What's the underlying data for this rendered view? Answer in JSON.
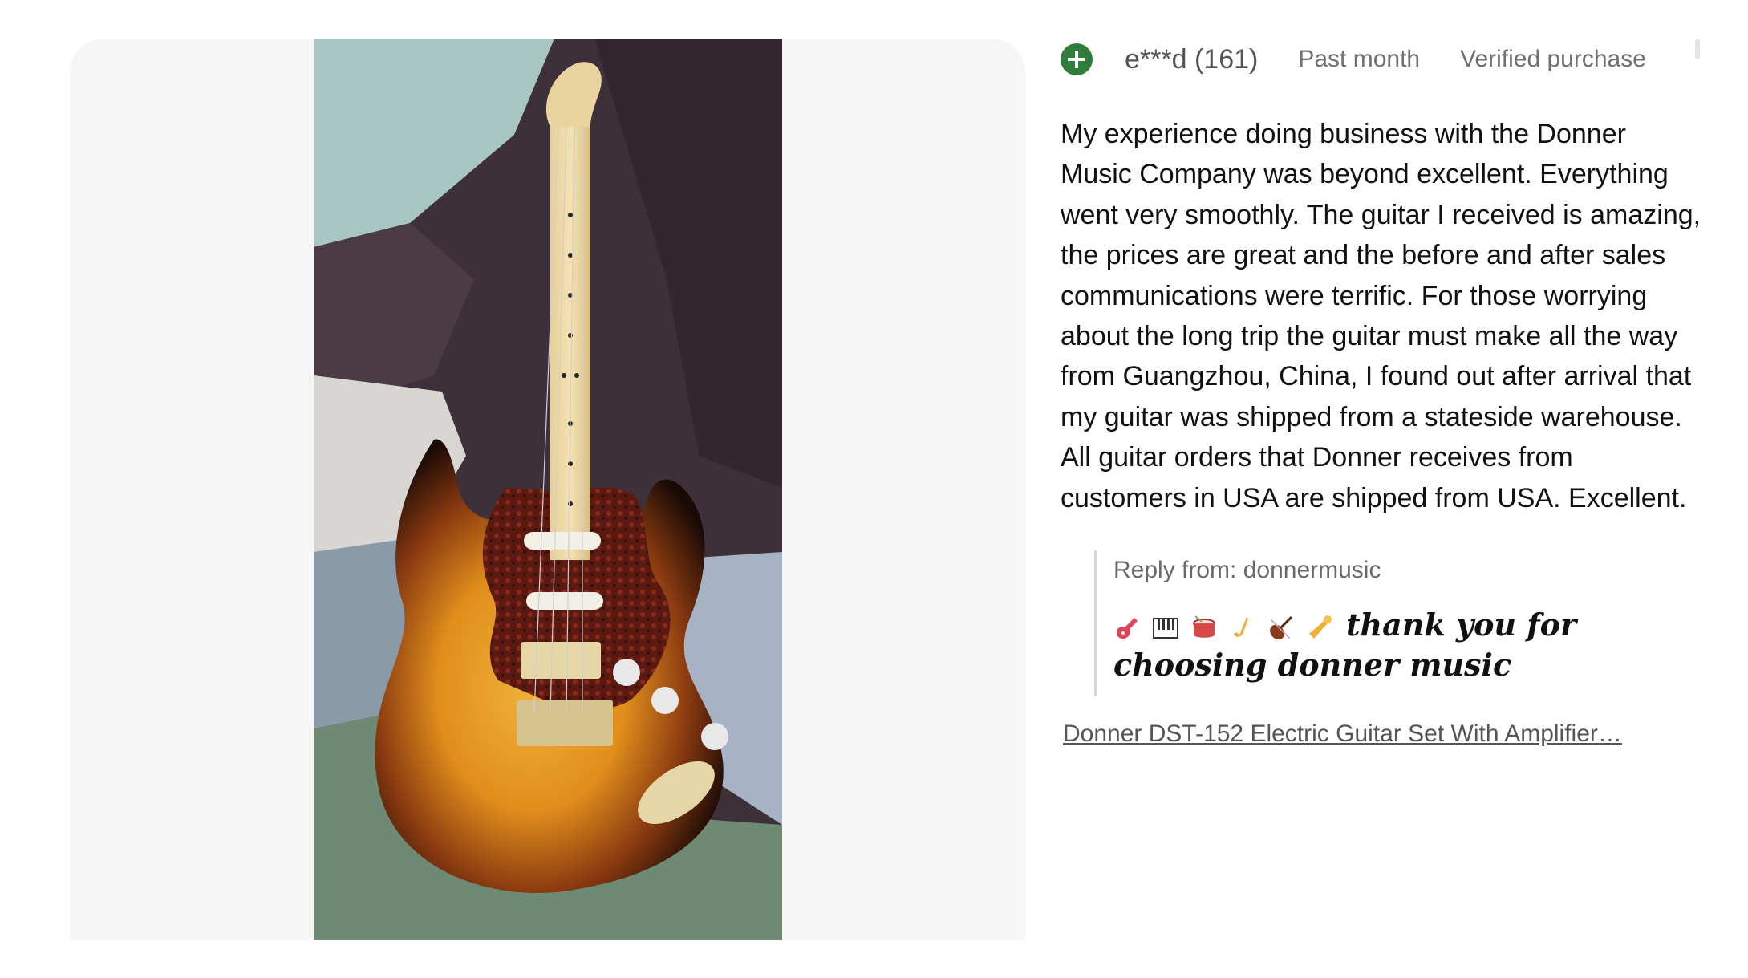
{
  "review": {
    "username": "e***d (161)",
    "time_ago": "Past month",
    "verified": "Verified purchase",
    "avatar_icon": "plus-circle-icon",
    "body": "My experience doing business with the Donner Music Company was beyond excellent. Everything went very smoothly. The guitar I received is amazing, the prices are great and the before and after sales communications were terrific. For those worrying about the long trip the guitar must make all the way from Guangzhou, China, I found out after arrival that my guitar was shipped from a stateside warehouse. All guitar orders that Donner receives from customers in USA are shipped from USA. Excellent."
  },
  "reply": {
    "from": "Reply from: donnermusic",
    "emoji_icons": [
      "guitar-icon",
      "piano-icon",
      "drum-icon",
      "saxophone-icon",
      "violin-icon",
      "trumpet-icon"
    ],
    "message": "thank you for choosing donner music"
  },
  "product": {
    "link_text": "Donner DST-152 Electric Guitar Set With Amplifier…"
  },
  "colors": {
    "accent_green": "#2e7d3c",
    "text": "#111111",
    "muted": "#707070",
    "card_bg": "#f6f6f6"
  }
}
